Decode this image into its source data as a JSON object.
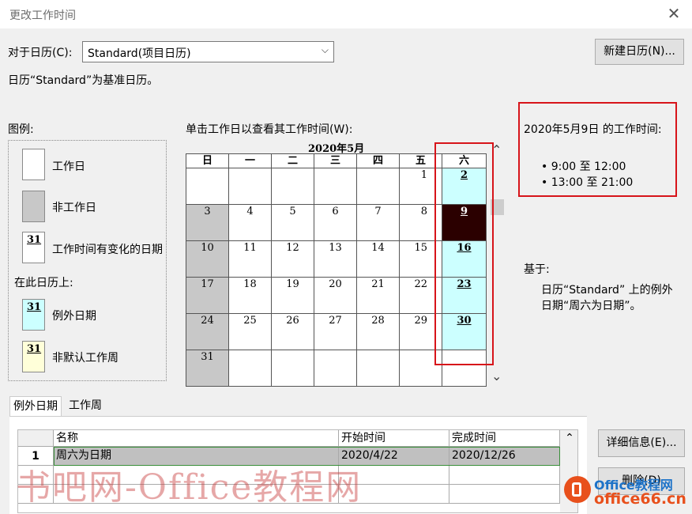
{
  "window": {
    "title": "更改工作时间"
  },
  "top": {
    "calendar_label": "对于日历(C):",
    "calendar_value": "Standard(项目日历)",
    "new_calendar_button": "新建日历(N)...",
    "base_note": "日历“Standard”为基准日历。"
  },
  "legend": {
    "title": "图例:",
    "items": [
      {
        "label": "工作日"
      },
      {
        "label": "非工作日"
      },
      {
        "label": "工作时间有变化的日期",
        "num": "31"
      },
      {
        "label": "例外日期",
        "num": "31"
      },
      {
        "label": "非默认工作周",
        "num": "31"
      }
    ],
    "on_calendar_label": "在此日历上:"
  },
  "calendar": {
    "instruction": "单击工作日以查看其工作时间(W):",
    "month_title": "2020年5月",
    "weekday_headers": [
      "日",
      "一",
      "二",
      "三",
      "四",
      "五",
      "六"
    ],
    "weeks": [
      [
        "",
        "",
        "",
        "",
        "",
        "1",
        "2"
      ],
      [
        "3",
        "4",
        "5",
        "6",
        "7",
        "8",
        "9"
      ],
      [
        "10",
        "11",
        "12",
        "13",
        "14",
        "15",
        "16"
      ],
      [
        "17",
        "18",
        "19",
        "20",
        "21",
        "22",
        "23"
      ],
      [
        "24",
        "25",
        "26",
        "27",
        "28",
        "29",
        "30"
      ],
      [
        "31",
        "",
        "",
        "",
        "",
        "",
        ""
      ]
    ],
    "scroll_up": "⌃",
    "scroll_down": "⌄"
  },
  "working_times": {
    "heading": "2020年5月9日 的工作时间:",
    "items": [
      "• 9:00 至 12:00",
      "• 13:00 至 21:00"
    ]
  },
  "based_on": {
    "label": "基于:",
    "text_line1": "日历“Standard” 上的例外",
    "text_line2": "日期“周六为日期”。"
  },
  "tabs": [
    "例外日期",
    "工作周"
  ],
  "exceptions_table": {
    "headers": [
      "名称",
      "开始时间",
      "完成时间"
    ],
    "rows": [
      {
        "index": "1",
        "name": "周六为日期",
        "start": "2020/4/22",
        "finish": "2020/12/26"
      }
    ]
  },
  "buttons": {
    "details": "详细信息(E)...",
    "delete": "删除(D)"
  },
  "watermark": {
    "text": "书吧网-Office教程网",
    "logo": "Office教程网",
    "url": "office66.cn"
  },
  "colors": {
    "nonworking": "#c8c8c8",
    "exception": "#ccffff",
    "nondefault_week": "#ffffd9",
    "selected_day": "#2b0000",
    "highlight_box": "#d7141a",
    "row_highlight": "#c0c0c0"
  }
}
